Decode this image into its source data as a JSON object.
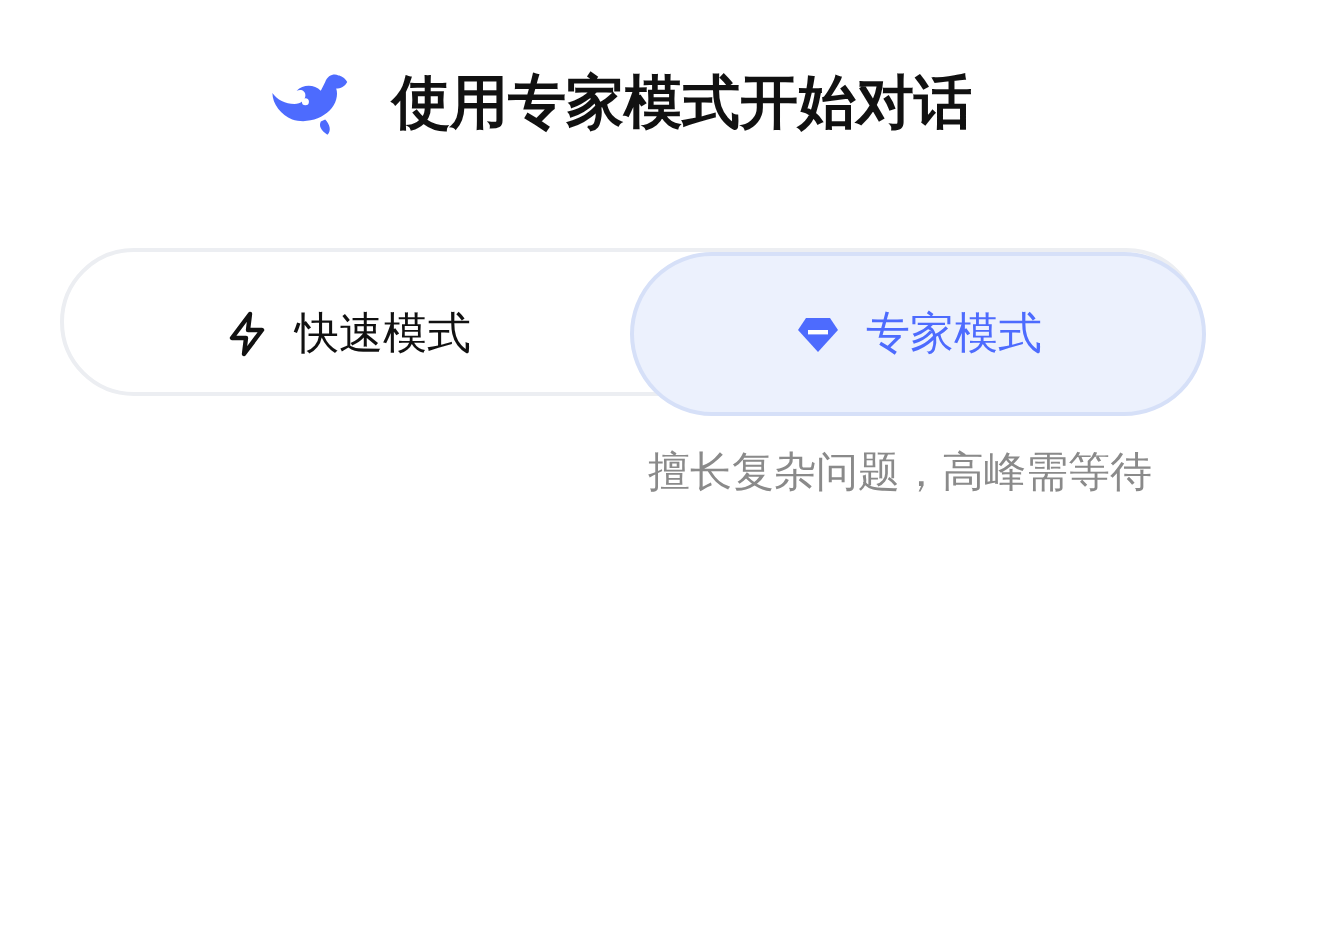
{
  "title": "使用专家模式开始对话",
  "modes": [
    {
      "kind": "lightning",
      "label": "快速模式",
      "selected": false
    },
    {
      "kind": "diamond",
      "label": "专家模式",
      "selected": true
    }
  ],
  "hint": "擅长复杂问题，高峰需等待"
}
